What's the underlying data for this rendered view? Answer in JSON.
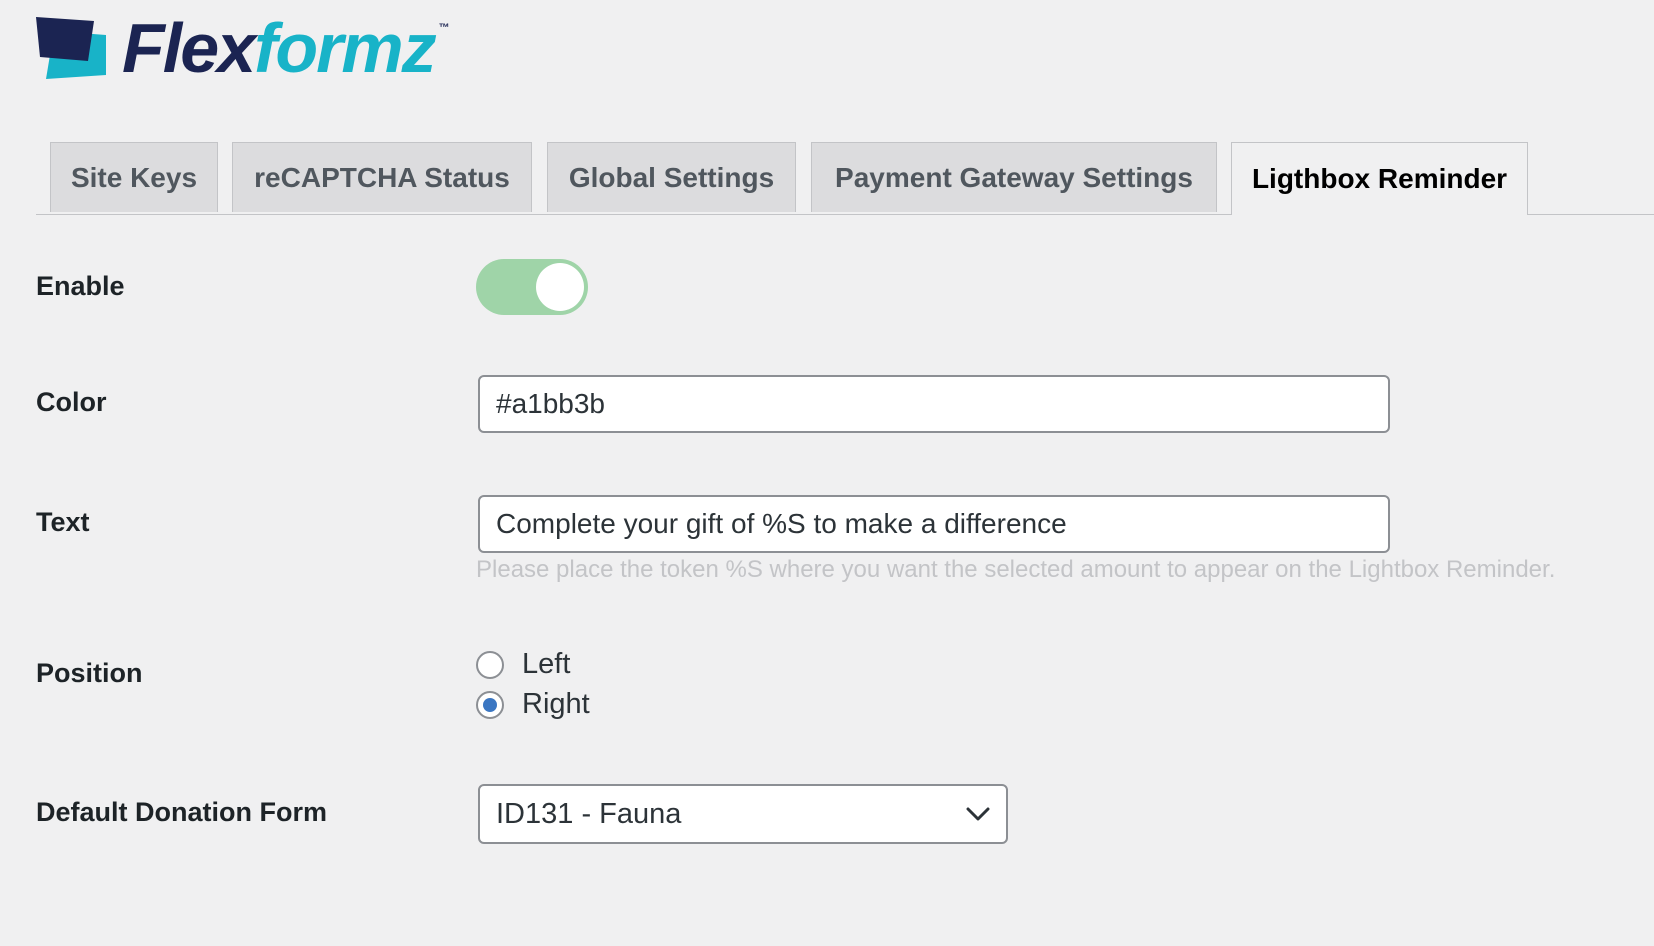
{
  "brand": {
    "name_part1": "Flex",
    "name_part2": "formz",
    "trademark": "™",
    "colors": {
      "dark": "#1b2452",
      "teal": "#18b3c8"
    }
  },
  "tabs": [
    {
      "label": "Site Keys",
      "active": false
    },
    {
      "label": "reCAPTCHA Status",
      "active": false
    },
    {
      "label": "Global Settings",
      "active": false
    },
    {
      "label": "Payment Gateway Settings",
      "active": false
    },
    {
      "label": "Ligthbox Reminder",
      "active": true
    }
  ],
  "form": {
    "enable": {
      "label": "Enable",
      "on": true,
      "color": "#9fd4a8"
    },
    "color": {
      "label": "Color",
      "value": "#a1bb3b"
    },
    "text": {
      "label": "Text",
      "value": "Complete your gift of %S to make a difference",
      "hint": "Please place the token %S where you want the selected amount to appear on the Lightbox Reminder."
    },
    "position": {
      "label": "Position",
      "options": [
        {
          "label": "Left",
          "checked": false
        },
        {
          "label": "Right",
          "checked": true
        }
      ],
      "accent": "#3a76c2"
    },
    "default_form": {
      "label": "Default Donation Form",
      "selected": "ID131 - Fauna",
      "icon": "chevron-down-icon"
    }
  }
}
